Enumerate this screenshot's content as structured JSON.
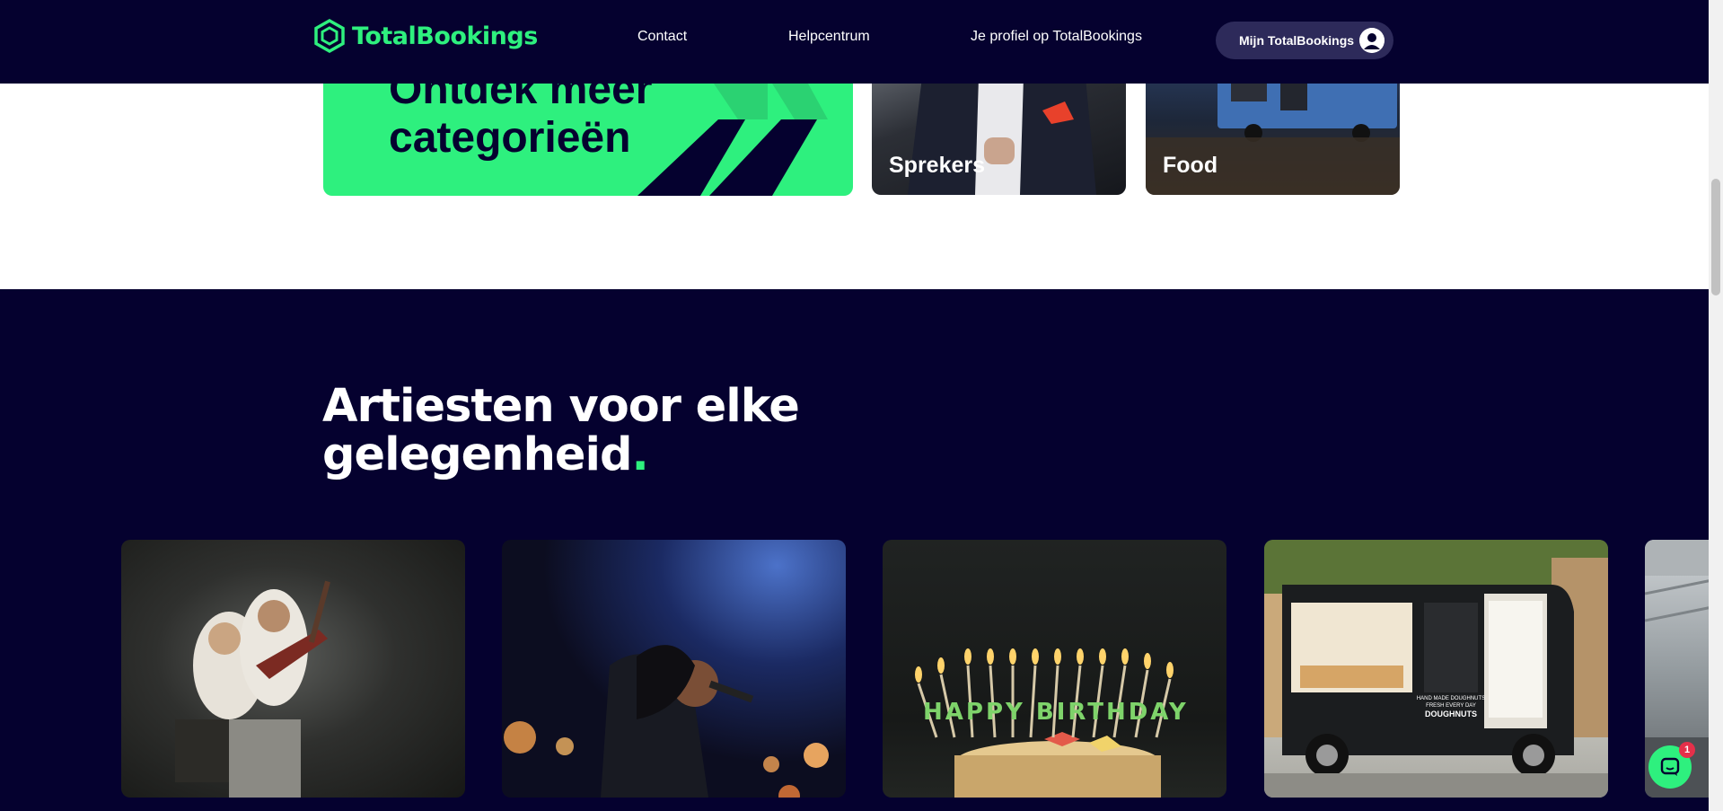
{
  "header": {
    "logo_text": "TotalBookings",
    "nav": {
      "contact": "Contact",
      "help": "Helpcentrum",
      "profile": "Je profiel op TotalBookings"
    },
    "account_button": "Mijn TotalBookings"
  },
  "categories": {
    "promo_line1": "Ontdek meer",
    "promo_line2": "categorieën",
    "tiles": [
      {
        "label": "Sprekers"
      },
      {
        "label": "Food"
      }
    ]
  },
  "section": {
    "title_line1": "Artiesten voor elke",
    "title_line2": "gelegenheid",
    "title_dot": "."
  },
  "cards": {
    "food_truck_sign": "HAND MADE DOUGHNUTS",
    "food_truck_sign2": "FRESH EVERY DAY",
    "food_truck_sign3": "DOUGHNUTS",
    "cake_text": "HAPPY BIRTHDAY"
  },
  "chat": {
    "badge_count": "1"
  },
  "colors": {
    "brand_dark": "#05012f",
    "brand_green": "#2ef07e",
    "account_button_bg": "#2d2a5a"
  }
}
